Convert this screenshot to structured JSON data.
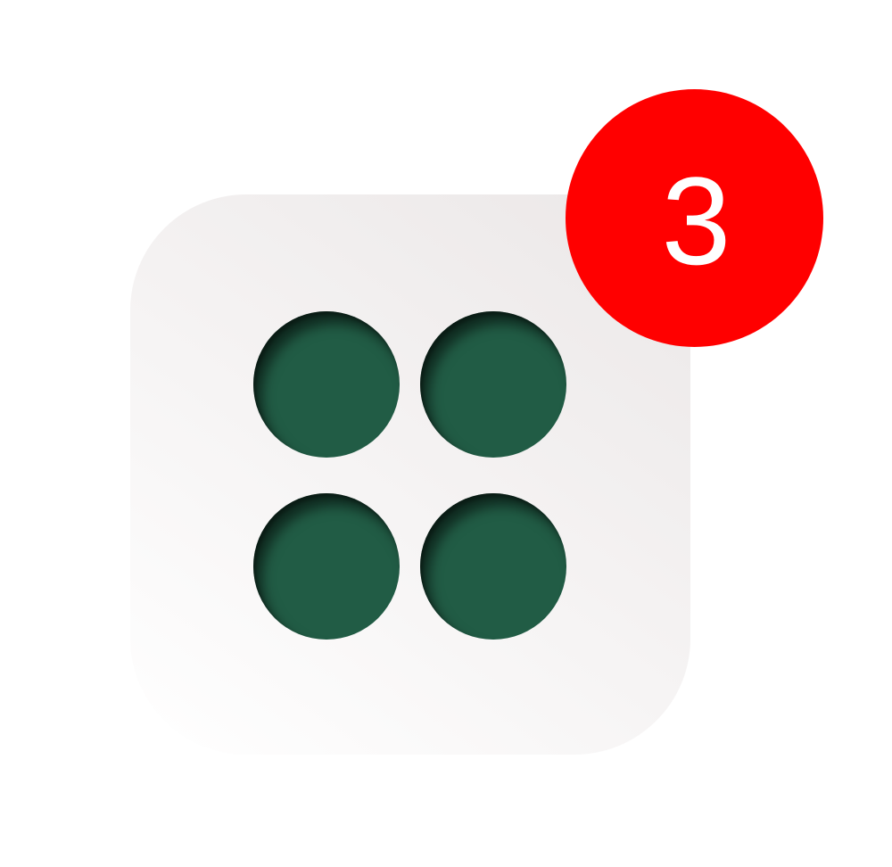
{
  "icon": {
    "name": "apps-grid-icon",
    "tile_color": "#efecec",
    "dot_color": "#215c45",
    "dot_count": 4
  },
  "badge": {
    "count": "3",
    "color": "#ff0000",
    "text_color": "#ffffff"
  }
}
